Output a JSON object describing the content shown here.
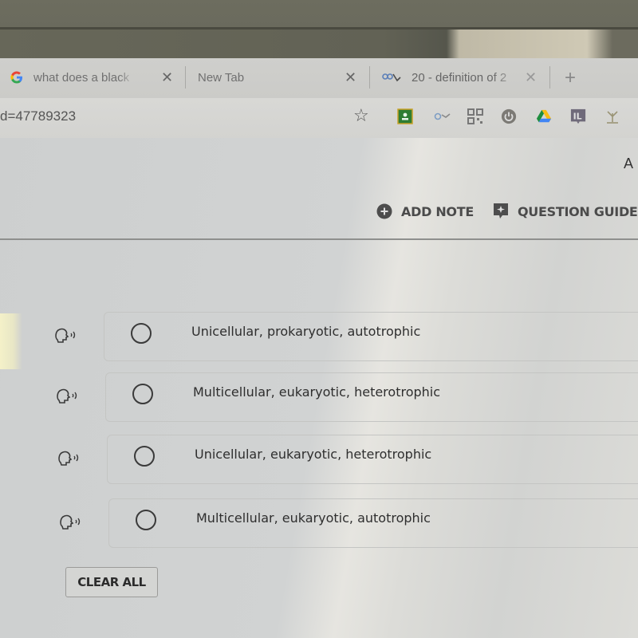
{
  "browser": {
    "tabs": [
      {
        "label": "what does a black",
        "favicon": "google-g-icon",
        "active": false
      },
      {
        "label": "New Tab",
        "favicon": null,
        "active": false
      },
      {
        "label": "20 - definition of 2",
        "favicon": "site-icon",
        "active": true
      }
    ],
    "new_tab_symbol": "+",
    "close_symbol": "✕",
    "url_fragment": "d=47789323",
    "bookmark_symbol": "☆",
    "extensions": [
      "google-classroom-icon",
      "reading-tool-icon",
      "qr-code-icon",
      "power-icon",
      "google-drive-icon",
      "immersive-reader-icon",
      "antenna-icon"
    ]
  },
  "page": {
    "corner_text": "A",
    "toolbar": {
      "add_note_label": "ADD NOTE",
      "question_guide_label": "QUESTION GUIDE"
    },
    "options": [
      {
        "text": "Unicellular, prokaryotic, autotrophic",
        "selected": false
      },
      {
        "text": "Multicellular, eukaryotic, heterotrophic",
        "selected": false
      },
      {
        "text": "Unicellular, eukaryotic, heterotrophic",
        "selected": false
      },
      {
        "text": "Multicellular, eukaryotic, autotrophic",
        "selected": false
      }
    ],
    "clear_all_label": "CLEAR ALL"
  }
}
